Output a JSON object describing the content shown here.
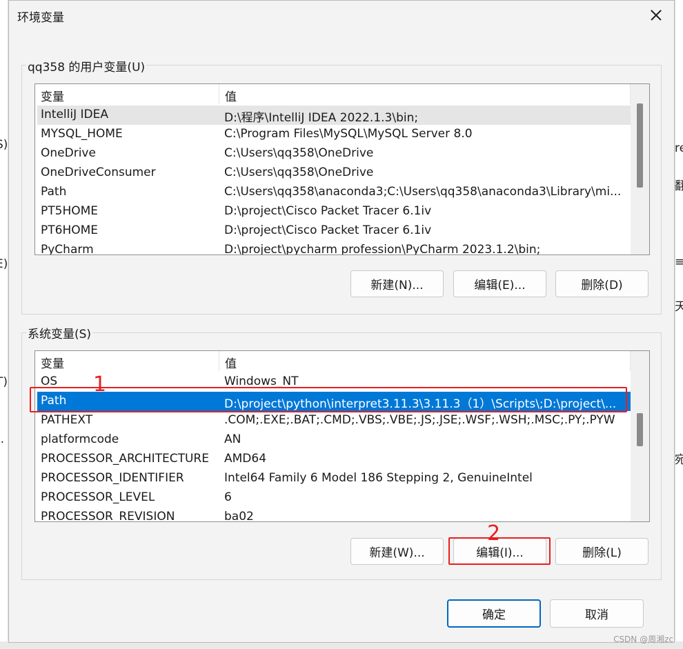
{
  "window": {
    "title": "环境变量",
    "close_label": "✕"
  },
  "user_vars": {
    "group_label": "qq358 的用户变量(U)",
    "header": {
      "name": "变量",
      "value": "值"
    },
    "rows": [
      {
        "name": "IntelliJ IDEA",
        "value": "D:\\程序\\IntelliJ IDEA 2022.1.3\\bin;"
      },
      {
        "name": "MYSQL_HOME",
        "value": "C:\\Program Files\\MySQL\\MySQL Server 8.0"
      },
      {
        "name": "OneDrive",
        "value": "C:\\Users\\qq358\\OneDrive"
      },
      {
        "name": "OneDriveConsumer",
        "value": "C:\\Users\\qq358\\OneDrive"
      },
      {
        "name": "Path",
        "value": "C:\\Users\\qq358\\anaconda3;C:\\Users\\qq358\\anaconda3\\Library\\mi..."
      },
      {
        "name": "PT5HOME",
        "value": "D:\\project\\Cisco Packet Tracer 6.1iv"
      },
      {
        "name": "PT6HOME",
        "value": "D:\\project\\Cisco Packet Tracer 6.1iv"
      },
      {
        "name": "PyCharm",
        "value": "D:\\project\\pycharm profession\\PyCharm 2023.1.2\\bin;"
      }
    ],
    "buttons": {
      "new": "新建(N)...",
      "edit": "编辑(E)...",
      "delete": "删除(D)"
    }
  },
  "system_vars": {
    "group_label": "系统变量(S)",
    "header": {
      "name": "变量",
      "value": "值"
    },
    "rows": [
      {
        "name": "OS",
        "value": "Windows_NT"
      },
      {
        "name": "Path",
        "value": "D:\\project\\python\\interpret3.11.3\\3.11.3（1）\\Scripts\\;D:\\project\\..."
      },
      {
        "name": "PATHEXT",
        "value": ".COM;.EXE;.BAT;.CMD;.VBS;.VBE;.JS;.JSE;.WSF;.WSH;.MSC;.PY;.PYW"
      },
      {
        "name": "platformcode",
        "value": "AN"
      },
      {
        "name": "PROCESSOR_ARCHITECTURE",
        "value": "AMD64"
      },
      {
        "name": "PROCESSOR_IDENTIFIER",
        "value": "Intel64 Family 6 Model 186 Stepping 2, GenuineIntel"
      },
      {
        "name": "PROCESSOR_LEVEL",
        "value": "6"
      },
      {
        "name": "PROCESSOR_REVISION",
        "value": "ba02"
      }
    ],
    "buttons": {
      "new": "新建(W)...",
      "edit": "编辑(I)...",
      "delete": "删除(L)"
    }
  },
  "footer": {
    "ok": "确定",
    "cancel": "取消"
  },
  "annotations": {
    "one": "1",
    "two": "2"
  },
  "watermark": "CSDN @周湘zc",
  "background_fragments": {
    "left_s": "S)",
    "left_e": "E)",
    "left_t": "T)",
    "left_o": ").",
    "right_re": "re",
    "right_ba": "翻",
    "right_eq": "≡",
    "right_tian": "天",
    "right_wan": "宛"
  },
  "colors": {
    "selection": "#0078d7",
    "annotation": "#e81e1e",
    "primary_border": "#0067c0"
  }
}
